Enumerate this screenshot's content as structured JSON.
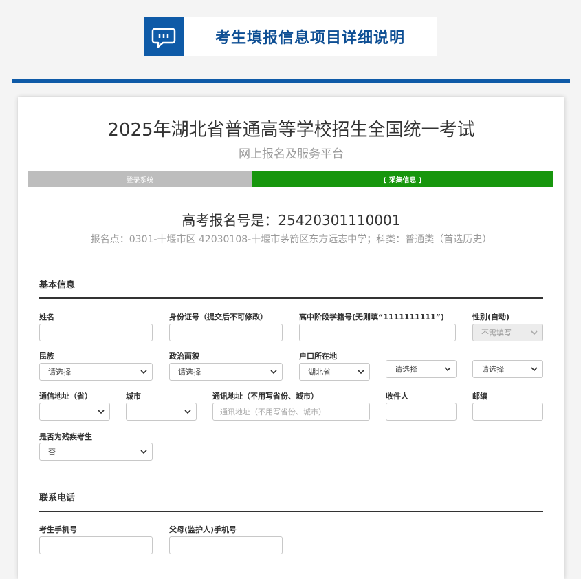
{
  "banner": {
    "title": "考生填报信息项目详细说明",
    "icon": "chat-bubble-icon"
  },
  "header": {
    "title": "2025年湖北省普通高等学校招生全国统一考试",
    "subtitle": "网上报名及服务平台"
  },
  "steps": [
    {
      "label": "登录系统"
    },
    {
      "label": "[ 采集信息 ]"
    }
  ],
  "registration": {
    "number_text": "高考报名号是：25420301110001",
    "site_text": "报名点：0301-十堰市区  42030108-十堰市茅箭区东方远志中学；科类：普通类（首选历史）"
  },
  "sections": {
    "basic": {
      "title": "基本信息"
    },
    "contact": {
      "title": "联系电话"
    }
  },
  "fields": {
    "name": {
      "label": "姓名",
      "value": ""
    },
    "id_card": {
      "label": "身份证号（提交后不可修改）",
      "value": ""
    },
    "school_id": {
      "label": "高中阶段学籍号(无则填“1111111111”)",
      "value": ""
    },
    "gender": {
      "label": "性别(自动)",
      "value": "不需填写"
    },
    "ethnicity": {
      "label": "民族",
      "value": "请选择"
    },
    "political": {
      "label": "政治面貌",
      "value": "请选择"
    },
    "hukou": {
      "label": "户口所在地",
      "province": "湖北省",
      "city": "请选择",
      "county": "请选择"
    },
    "mail_province": {
      "label": "通信地址（省）",
      "value": ""
    },
    "mail_city": {
      "label": "城市",
      "value": ""
    },
    "mail_address": {
      "label": "通讯地址（不用写省份、城市）",
      "placeholder": "通讯地址（不用写省份、城市）"
    },
    "recipient": {
      "label": "收件人",
      "value": ""
    },
    "postcode": {
      "label": "邮编",
      "value": ""
    },
    "disabled": {
      "label": "是否为残疾考生",
      "value": "否"
    },
    "student_phone": {
      "label": "考生手机号",
      "value": ""
    },
    "parent_phone": {
      "label": "父母(监护人)手机号",
      "value": ""
    }
  }
}
